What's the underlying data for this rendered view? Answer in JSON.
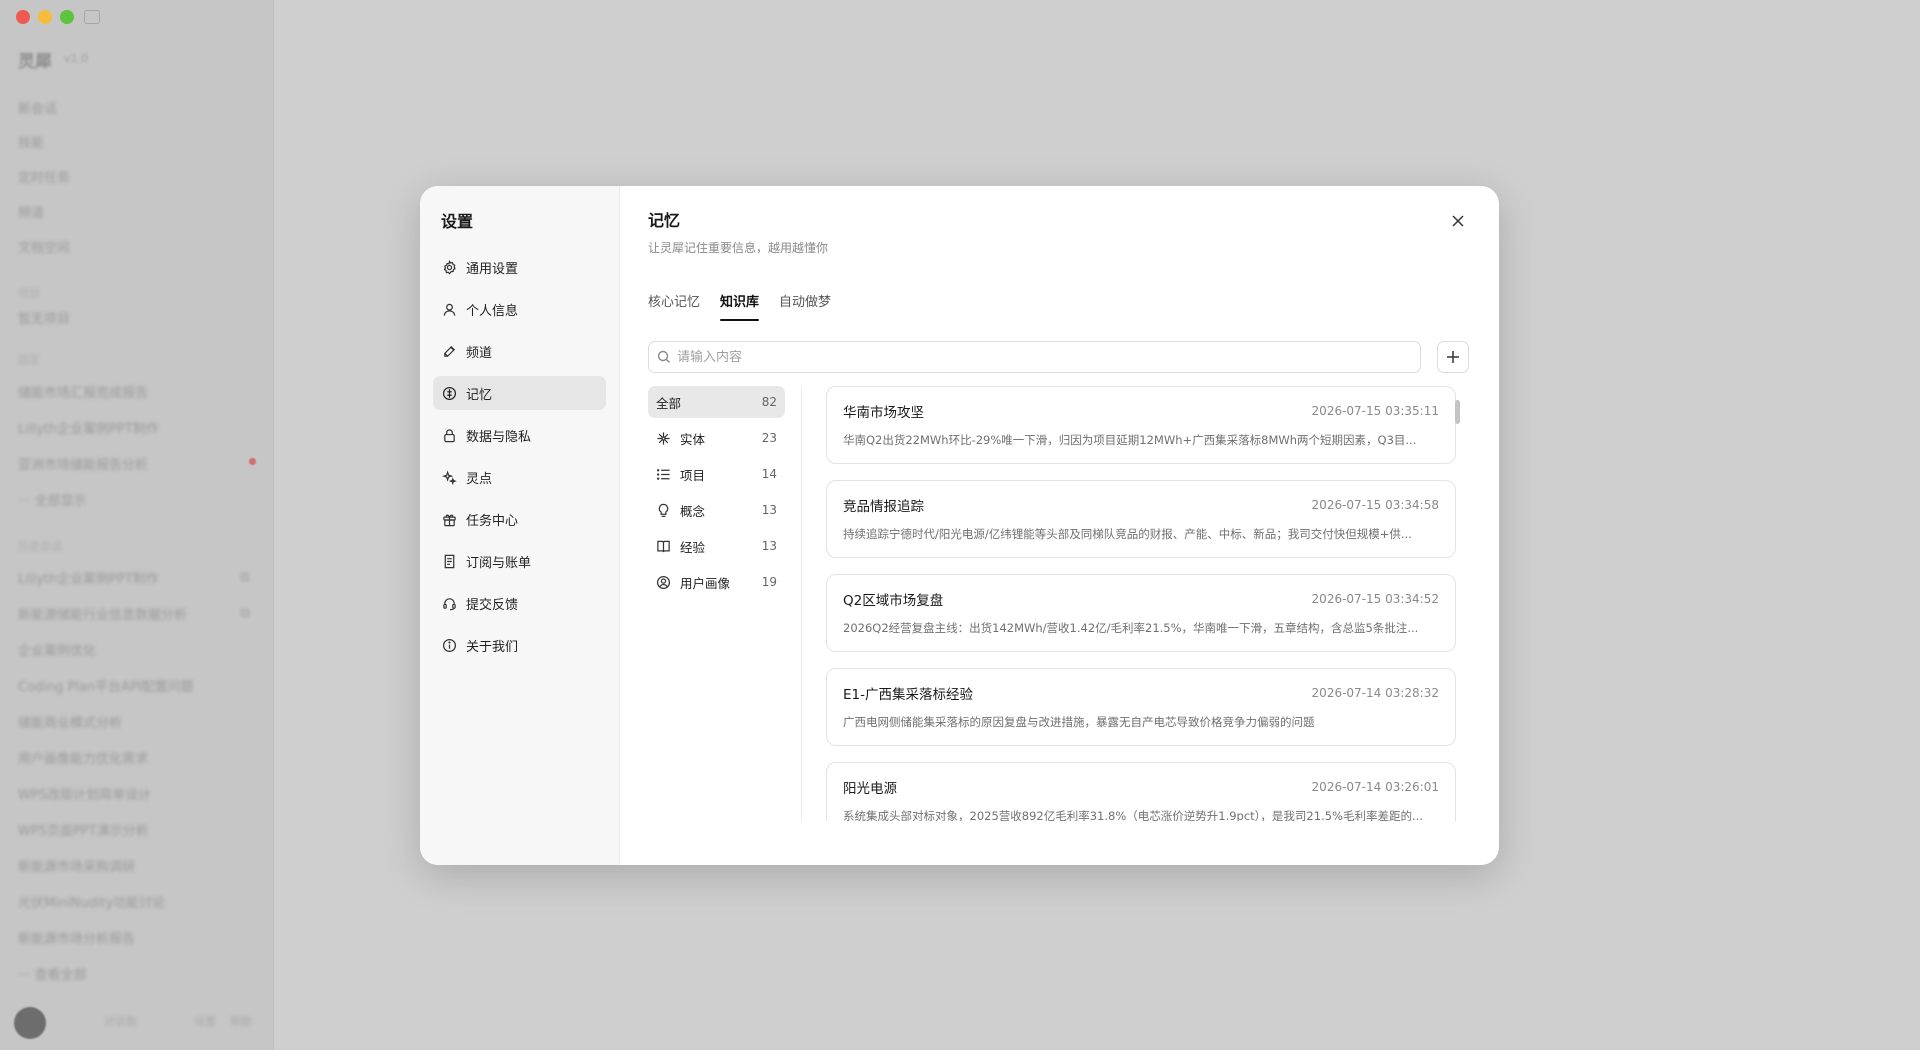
{
  "background_app": {
    "brand": "灵犀",
    "brand_sub": "v1.0",
    "menu": [
      "新会话",
      "技能",
      "定时任务",
      "频道",
      "文档空间"
    ],
    "sections": [
      {
        "label": "项目",
        "items": [
          "暂无项目"
        ]
      },
      {
        "label": "固定",
        "items": [
          "储能市场汇报完成报告",
          "Lillyth企业案例PPT制作",
          "亚洲市场储能报告分析",
          "··· 全部显示"
        ]
      },
      {
        "label": "历史会话",
        "items": [
          "Lillyth企业案例PPT制作",
          "新能源储能行业信息数据分析",
          "企业案例优化",
          "Coding Plan平台API配置问题",
          "储能商业模式分析",
          "用户画像能力优化需求",
          "WPS改版计划简单设计",
          "WPS页面PPT演示分析",
          "新能源市场采购调研",
          "光伏MiniNudity功能讨论",
          "新能源市场分析报告",
          "··· 查看全部"
        ]
      }
    ],
    "footer": [
      "对话数",
      "设置",
      "帮助"
    ]
  },
  "settings": {
    "title": "设置",
    "nav": [
      {
        "label": "通用设置",
        "icon": "gear-icon",
        "active": false
      },
      {
        "label": "个人信息",
        "icon": "user-icon",
        "active": false
      },
      {
        "label": "频道",
        "icon": "channel-icon",
        "active": false
      },
      {
        "label": "记忆",
        "icon": "memory-icon",
        "active": true
      },
      {
        "label": "数据与隐私",
        "icon": "lock-icon",
        "active": false
      },
      {
        "label": "灵点",
        "icon": "sparkle-icon",
        "active": false
      },
      {
        "label": "任务中心",
        "icon": "gift-icon",
        "active": false
      },
      {
        "label": "订阅与账单",
        "icon": "receipt-icon",
        "active": false
      },
      {
        "label": "提交反馈",
        "icon": "headset-icon",
        "active": false
      },
      {
        "label": "关于我们",
        "icon": "info-icon",
        "active": false
      }
    ]
  },
  "memory": {
    "title": "记忆",
    "subtitle": "让灵犀记住重要信息，越用越懂你",
    "tabs": [
      {
        "label": "核心记忆",
        "active": false
      },
      {
        "label": "知识库",
        "active": true
      },
      {
        "label": "自动做梦",
        "active": false
      }
    ],
    "search": {
      "placeholder": "请输入内容"
    },
    "categories": [
      {
        "label": "全部",
        "count": "82",
        "icon": "",
        "active": true
      },
      {
        "label": "实体",
        "count": "23",
        "icon": "entity-icon",
        "active": false
      },
      {
        "label": "项目",
        "count": "14",
        "icon": "list-icon",
        "active": false
      },
      {
        "label": "概念",
        "count": "13",
        "icon": "lightbulb-icon",
        "active": false
      },
      {
        "label": "经验",
        "count": "13",
        "icon": "book-icon",
        "active": false
      },
      {
        "label": "用户画像",
        "count": "19",
        "icon": "user-circle-icon",
        "active": false
      }
    ],
    "cards": [
      {
        "title": "华南市场攻坚",
        "time": "2026-07-15 03:35:11",
        "desc": "华南Q2出货22MWh环比-29%唯一下滑，归因为项目延期12MWh+广西集采落标8MWh两个短期因素，Q3目..."
      },
      {
        "title": "竞品情报追踪",
        "time": "2026-07-15 03:34:58",
        "desc": "持续追踪宁德时代/阳光电源/亿纬锂能等头部及同梯队竞品的财报、产能、中标、新品；我司交付快但规模+供..."
      },
      {
        "title": "Q2区域市场复盘",
        "time": "2026-07-15 03:34:52",
        "desc": "2026Q2经营复盘主线：出货142MWh/营收1.42亿/毛利率21.5%，华南唯一下滑，五章结构，含总监5条批注..."
      },
      {
        "title": "E1-广西集采落标经验",
        "time": "2026-07-14 03:28:32",
        "desc": "广西电网侧储能集采落标的原因复盘与改进措施，暴露无自产电芯导致价格竞争力偏弱的问题"
      },
      {
        "title": "阳光电源",
        "time": "2026-07-14 03:26:01",
        "desc": "系统集成头部对标对象，2025营收892亿毛利率31.8%（电芯涨价逆势升1.9pct），是我司21.5%毛利率差距的..."
      }
    ]
  }
}
